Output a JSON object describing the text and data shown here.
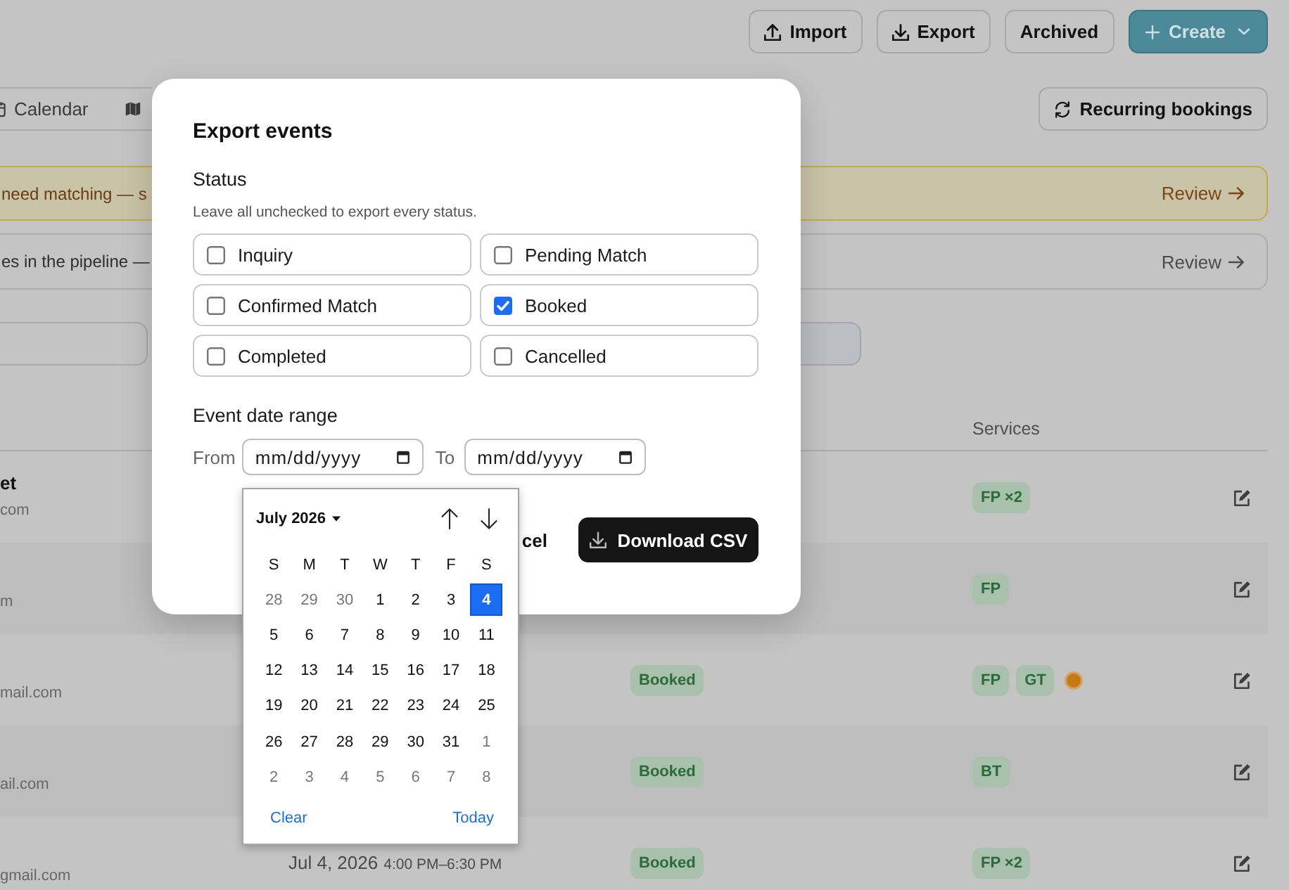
{
  "toolbar": {
    "buttons": [
      {
        "kind": "import",
        "label": "Import"
      },
      {
        "kind": "export",
        "label": "Export"
      },
      {
        "kind": "archive",
        "label": "Archived"
      },
      {
        "kind": "create",
        "label": "Create"
      }
    ]
  },
  "view_tabs": [
    {
      "kind": "calendar",
      "label": "Calendar"
    },
    {
      "kind": "map"
    }
  ],
  "recurring_button": {
    "label": "Recurring bookings"
  },
  "banners": [
    {
      "kind": "warning",
      "text": "need matching — s",
      "action": "Review"
    },
    {
      "kind": "info",
      "text": "es in the pipeline —",
      "action": "Review"
    }
  ],
  "table": {
    "header": {
      "services": "Services"
    },
    "rows": [
      {
        "name": "et",
        "email": "com",
        "services": [
          "FP ×2"
        ],
        "flagged": false
      },
      {
        "email": "m",
        "services": [
          "FP"
        ],
        "flagged": false
      },
      {
        "email": "mail.com",
        "status": "Booked",
        "services": [
          "FP",
          "GT"
        ],
        "flagged": true
      },
      {
        "email": "ail.com",
        "status": "Booked",
        "services": [
          "BT"
        ],
        "flagged": false
      },
      {
        "email": "gmail.com",
        "date": "Jul 4, 2026",
        "time": "4:00 PM–6:30 PM",
        "status": "Booked",
        "services": [
          "FP ×2"
        ],
        "flagged": false
      }
    ]
  },
  "modal": {
    "title": "Export events",
    "status_label": "Status",
    "status_hint": "Leave all unchecked to export every status.",
    "statuses": [
      {
        "label": "Inquiry",
        "checked": false
      },
      {
        "label": "Pending Match",
        "checked": false
      },
      {
        "label": "Confirmed Match",
        "checked": false
      },
      {
        "label": "Booked",
        "checked": true
      },
      {
        "label": "Completed",
        "checked": false
      },
      {
        "label": "Cancelled",
        "checked": false
      }
    ],
    "date_range_label": "Event date range",
    "from_label": "From",
    "from_placeholder": "mm/dd/yyyy",
    "to_label": "To",
    "to_placeholder": "mm/dd/yyyy",
    "cancel": "cel",
    "download": "Download CSV"
  },
  "date_picker": {
    "month": "July 2026",
    "weekdays": [
      "S",
      "M",
      "T",
      "W",
      "T",
      "F",
      "S"
    ],
    "weeks": [
      [
        {
          "day": "28",
          "outside": true,
          "selected": false
        },
        {
          "day": "29",
          "outside": true,
          "selected": false
        },
        {
          "day": "30",
          "outside": true,
          "selected": false
        },
        {
          "day": "1",
          "outside": false,
          "selected": false
        },
        {
          "day": "2",
          "outside": false,
          "selected": false
        },
        {
          "day": "3",
          "outside": false,
          "selected": false
        },
        {
          "day": "4",
          "outside": false,
          "selected": true
        }
      ],
      [
        {
          "day": "5",
          "outside": false,
          "selected": false
        },
        {
          "day": "6",
          "outside": false,
          "selected": false
        },
        {
          "day": "7",
          "outside": false,
          "selected": false
        },
        {
          "day": "8",
          "outside": false,
          "selected": false
        },
        {
          "day": "9",
          "outside": false,
          "selected": false
        },
        {
          "day": "10",
          "outside": false,
          "selected": false
        },
        {
          "day": "11",
          "outside": false,
          "selected": false
        }
      ],
      [
        {
          "day": "12",
          "outside": false,
          "selected": false
        },
        {
          "day": "13",
          "outside": false,
          "selected": false
        },
        {
          "day": "14",
          "outside": false,
          "selected": false
        },
        {
          "day": "15",
          "outside": false,
          "selected": false
        },
        {
          "day": "16",
          "outside": false,
          "selected": false
        },
        {
          "day": "17",
          "outside": false,
          "selected": false
        },
        {
          "day": "18",
          "outside": false,
          "selected": false
        }
      ],
      [
        {
          "day": "19",
          "outside": false,
          "selected": false
        },
        {
          "day": "20",
          "outside": false,
          "selected": false
        },
        {
          "day": "21",
          "outside": false,
          "selected": false
        },
        {
          "day": "22",
          "outside": false,
          "selected": false
        },
        {
          "day": "23",
          "outside": false,
          "selected": false
        },
        {
          "day": "24",
          "outside": false,
          "selected": false
        },
        {
          "day": "25",
          "outside": false,
          "selected": false
        }
      ],
      [
        {
          "day": "26",
          "outside": false,
          "selected": false
        },
        {
          "day": "27",
          "outside": false,
          "selected": false
        },
        {
          "day": "28",
          "outside": false,
          "selected": false
        },
        {
          "day": "29",
          "outside": false,
          "selected": false
        },
        {
          "day": "30",
          "outside": false,
          "selected": false
        },
        {
          "day": "31",
          "outside": false,
          "selected": false
        },
        {
          "day": "1",
          "outside": true,
          "selected": false
        }
      ],
      [
        {
          "day": "2",
          "outside": true,
          "selected": false
        },
        {
          "day": "3",
          "outside": true,
          "selected": false
        },
        {
          "day": "4",
          "outside": true,
          "selected": false
        },
        {
          "day": "5",
          "outside": true,
          "selected": false
        },
        {
          "day": "6",
          "outside": true,
          "selected": false
        },
        {
          "day": "7",
          "outside": true,
          "selected": false
        },
        {
          "day": "8",
          "outside": true,
          "selected": false
        }
      ]
    ],
    "clear": "Clear",
    "today": "Today"
  }
}
